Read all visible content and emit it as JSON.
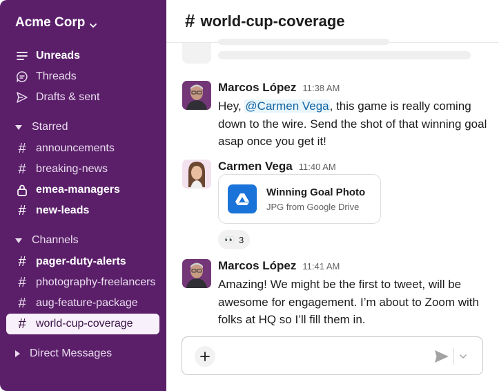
{
  "sidebar": {
    "workspace_name": "Acme Corp",
    "top_items": [
      {
        "label": "Unreads",
        "icon": "unreads-icon"
      },
      {
        "label": "Threads",
        "icon": "threads-icon"
      },
      {
        "label": "Drafts & sent",
        "icon": "drafts-sent-icon"
      }
    ],
    "starred_label": "Starred",
    "starred_channels": [
      {
        "label": "announcements",
        "icon": "hash-icon"
      },
      {
        "label": "breaking-news",
        "icon": "hash-icon"
      },
      {
        "label": "emea-managers",
        "icon": "lock-icon"
      },
      {
        "label": "new-leads",
        "icon": "hash-icon"
      }
    ],
    "channels_label": "Channels",
    "channels": [
      {
        "label": "pager-duty-alerts",
        "icon": "hash-icon"
      },
      {
        "label": "photography-freelancers",
        "icon": "hash-icon"
      },
      {
        "label": "aug-feature-package",
        "icon": "hash-icon"
      },
      {
        "label": "world-cup-coverage",
        "icon": "hash-icon",
        "active": true
      }
    ],
    "direct_messages_label": "Direct Messages"
  },
  "channel": {
    "hash": "#",
    "name": "world-cup-coverage"
  },
  "messages": [
    {
      "author": "Marcos López",
      "time": "11:38 AM",
      "text_before": "Hey, ",
      "mention": "@Carmen Vega",
      "text_after": ", this game is really coming down to the wire. Send the shot of that winning goal asap once you get it!"
    },
    {
      "author": "Carmen Vega",
      "time": "11:40 AM",
      "file": {
        "title": "Winning Goal Photo",
        "subtitle": "JPG from Google Drive",
        "icon": "google-drive-icon"
      },
      "reaction": {
        "emoji": "👀",
        "count": "3"
      }
    },
    {
      "author": "Marcos López",
      "time": "11:41 AM",
      "text": "Amazing! We might be the first to tweet, will be awesome for engagement. I’m about to Zoom with folks at HQ so I’ll fill them in."
    }
  ],
  "composer": {
    "placeholder": ""
  },
  "colors": {
    "sidebar_bg": "#5b1f6a",
    "active_item_bg": "#f8f0fa",
    "mention_bg": "#e8f5fa",
    "mention_text": "#1264a3",
    "drive_blue": "#1a73d9"
  }
}
